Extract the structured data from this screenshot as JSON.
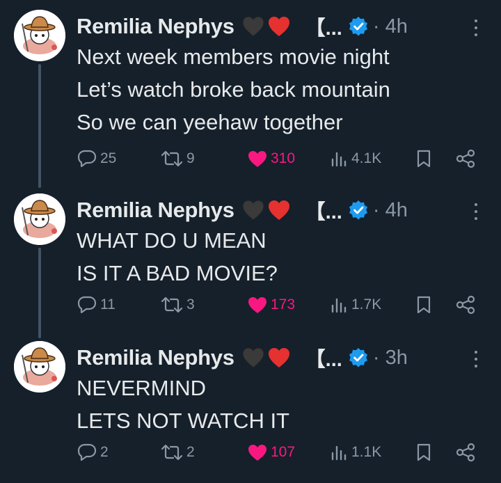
{
  "tweets": [
    {
      "author": "Remilia Nephys",
      "handle_truncated": "【...",
      "time": "4h",
      "lines": [
        "Next week members movie night",
        "Let’s watch broke back mountain",
        "So we can yeehaw together"
      ],
      "replies": "25",
      "retweets": "9",
      "likes": "310",
      "views": "4.1K"
    },
    {
      "author": "Remilia Nephys",
      "handle_truncated": "【...",
      "time": "4h",
      "lines": [
        "WHAT DO U MEAN",
        "IS IT A BAD MOVIE?"
      ],
      "replies": "11",
      "retweets": "3",
      "likes": "173",
      "views": "1.7K"
    },
    {
      "author": "Remilia Nephys",
      "handle_truncated": "【...",
      "time": "3h",
      "lines": [
        "NEVERMIND",
        "LETS NOT WATCH IT"
      ],
      "replies": "2",
      "retweets": "2",
      "likes": "107",
      "views": "1.1K"
    }
  ],
  "time_separator": "·",
  "colors": {
    "background": "#15202b",
    "text": "#e7e9ea",
    "muted": "#8b98a5",
    "like_pink": "#f91880",
    "verified_blue": "#1d9bf0",
    "thread_line": "#425364"
  },
  "icons": {
    "reply": "speech-bubble-icon",
    "retweet": "retweet-arrows-icon",
    "like": "heart-filled-icon",
    "views": "bar-chart-icon",
    "bookmark": "bookmark-icon",
    "share": "share-nodes-icon",
    "more": "three-dots-vertical-icon",
    "verified": "verified-badge-icon",
    "emoji": [
      "black-heart-emoji",
      "red-heart-emoji"
    ]
  }
}
